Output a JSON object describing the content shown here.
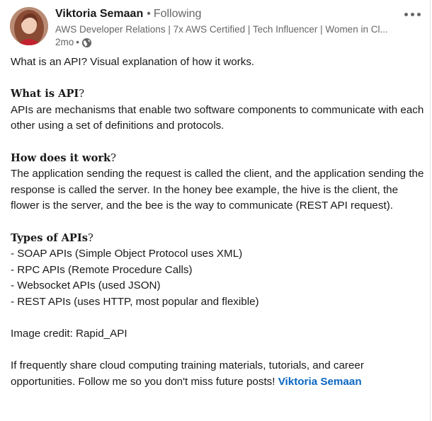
{
  "author": {
    "name": "Viktoria Semaan",
    "separator": "•",
    "follow_status": "Following",
    "headline": "AWS Developer Relations | 7x AWS Certified | Tech Influencer | Women in Cl...",
    "time": "2mo",
    "time_separator": "•",
    "visibility_icon": "globe-icon"
  },
  "menu": {
    "icon": "more-horizontal-icon"
  },
  "post": {
    "intro": "What is an API? Visual explanation of how it works.",
    "section1_heading": "What is API",
    "section1_qmark": "?",
    "section1_text": "APIs are mechanisms that enable two software components to communicate with each other using a set of definitions and protocols.",
    "section2_heading": "How does it work",
    "section2_qmark": "?",
    "section2_text": "The application sending the request is called the client, and the application sending the response is called the server. In the honey bee example, the hive is the client, the flower is the server, and the bee is the way to communicate (REST API request).",
    "section3_heading": "Types of APIs",
    "section3_qmark": "?",
    "types": [
      "- SOAP APIs (Simple Object Protocol uses XML)",
      "- RPC APIs (Remote Procedure Calls)",
      "- Websocket APIs (used JSON)",
      "- REST APIs (uses HTTP, most popular and flexible)"
    ],
    "credit": "Image credit: Rapid_API",
    "closing_text": "If frequently share cloud computing training materials, tutorials, and career opportunities. Follow me so you don't miss future posts! ",
    "closing_mention": "Viktoria Semaan"
  }
}
